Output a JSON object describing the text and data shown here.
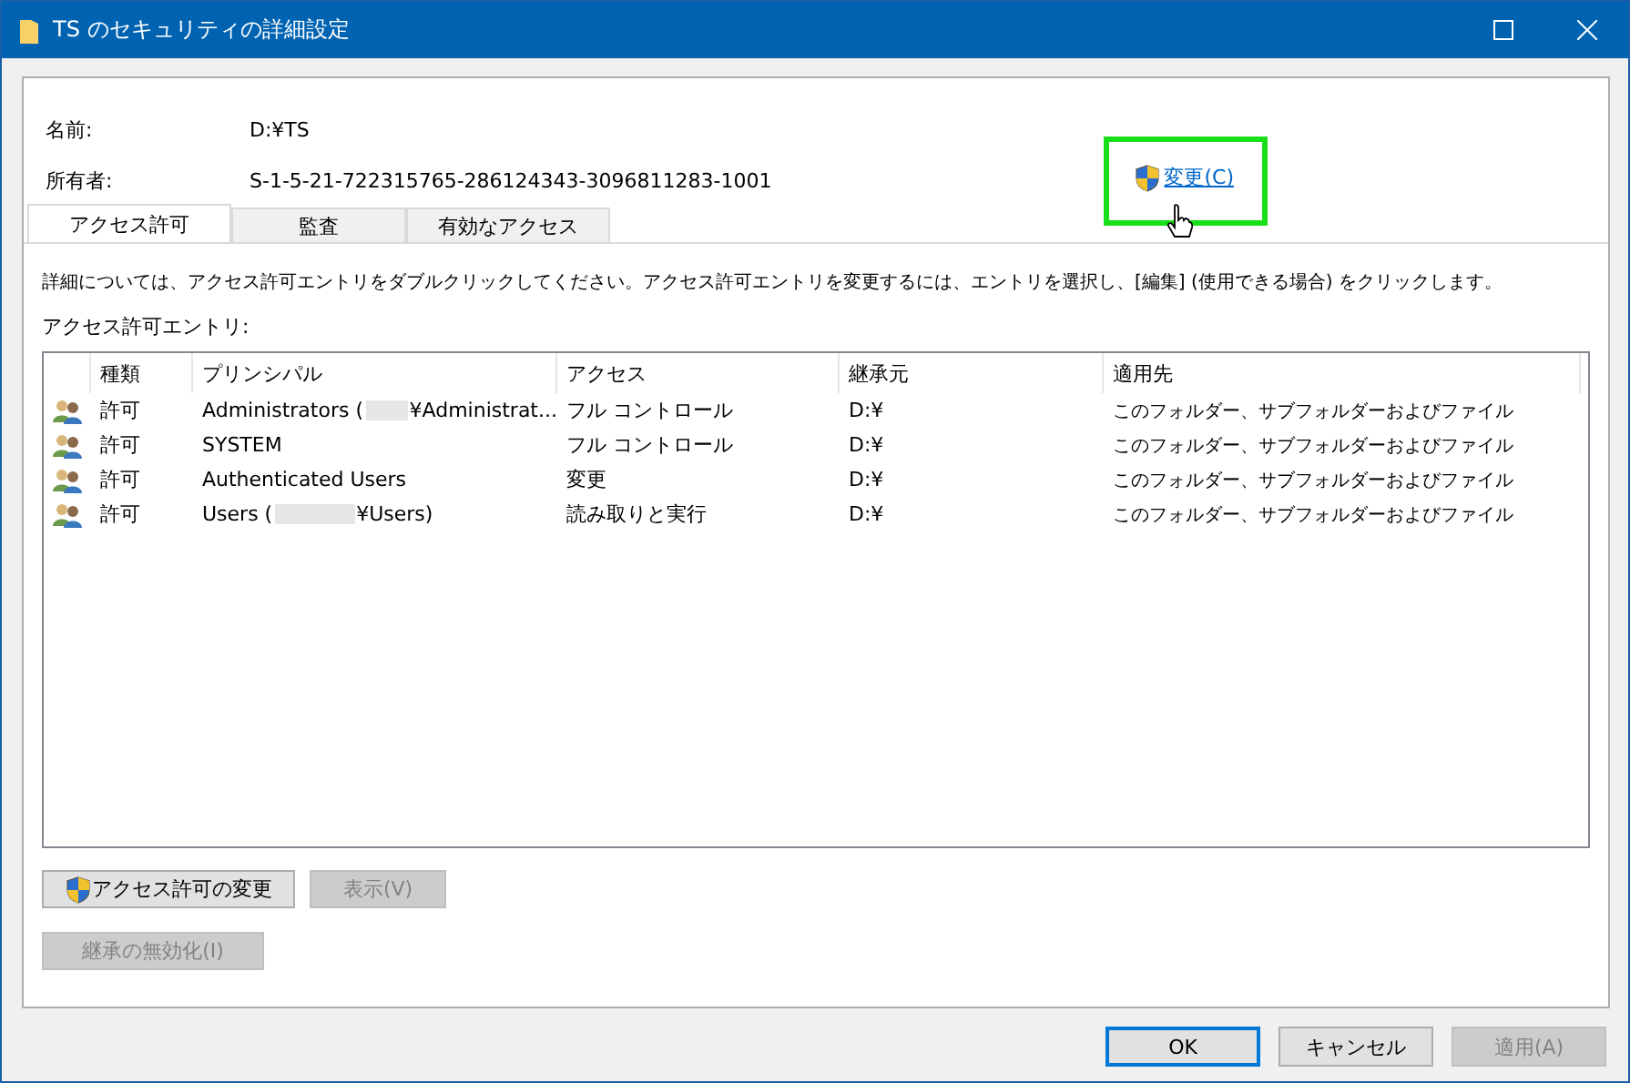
{
  "window": {
    "title": "TS のセキュリティの詳細設定",
    "buttons": [
      "OK",
      "キャンセル",
      "適用(A)"
    ],
    "disabled": [
      false,
      false,
      true
    ],
    "default": [
      true,
      false,
      false
    ]
  },
  "name": {
    "label": "名前:",
    "value": "D:¥TS"
  },
  "owner": {
    "label": "所有者:",
    "value": "S-1-5-21-722315765-286124343-3096811283-1001",
    "change_link": {
      "label": "変更(C)",
      "highlighted": true,
      "hovered": true
    }
  },
  "tabs": [
    {
      "label": "アクセス許可",
      "selected": true
    },
    {
      "label": "監査",
      "selected": false
    },
    {
      "label": "有効なアクセス",
      "selected": false
    }
  ],
  "description": "詳細については、アクセス許可エントリをダブルクリックしてください。アクセス許可エントリを変更するには、エントリを選択し、[編集] (使用できる場合) をクリックします。",
  "entries_label": "アクセス許可エントリ:",
  "table": {
    "columns": [
      "種類",
      "プリンシパル",
      "アクセス",
      "継承元",
      "適用先"
    ],
    "rows": [
      {
        "type": "許可",
        "principal": [
          "Administrators (",
          "¥Administrat..."
        ],
        "access": "フル コントロール",
        "inherited_from": "D:¥",
        "applies_to": "このフォルダー、サブフォルダーおよびファイル"
      },
      {
        "type": "許可",
        "principal": [
          "SYSTEM"
        ],
        "access": "フル コントロール",
        "inherited_from": "D:¥",
        "applies_to": "このフォルダー、サブフォルダーおよびファイル"
      },
      {
        "type": "許可",
        "principal": [
          "Authenticated Users"
        ],
        "access": "変更",
        "inherited_from": "D:¥",
        "applies_to": "このフォルダー、サブフォルダーおよびファイル"
      },
      {
        "type": "許可",
        "principal": [
          "Users (",
          "¥Users)"
        ],
        "access": "読み取りと実行",
        "inherited_from": "D:¥",
        "applies_to": "このフォルダー、サブフォルダーおよびファイル"
      }
    ]
  },
  "actions": [
    {
      "label": "アクセス許可の変更",
      "shield": true,
      "disabled": false
    },
    {
      "label": "表示(V)",
      "shield": false,
      "disabled": true
    },
    {
      "label": "継承の無効化(I)",
      "shield": false,
      "disabled": true
    }
  ]
}
